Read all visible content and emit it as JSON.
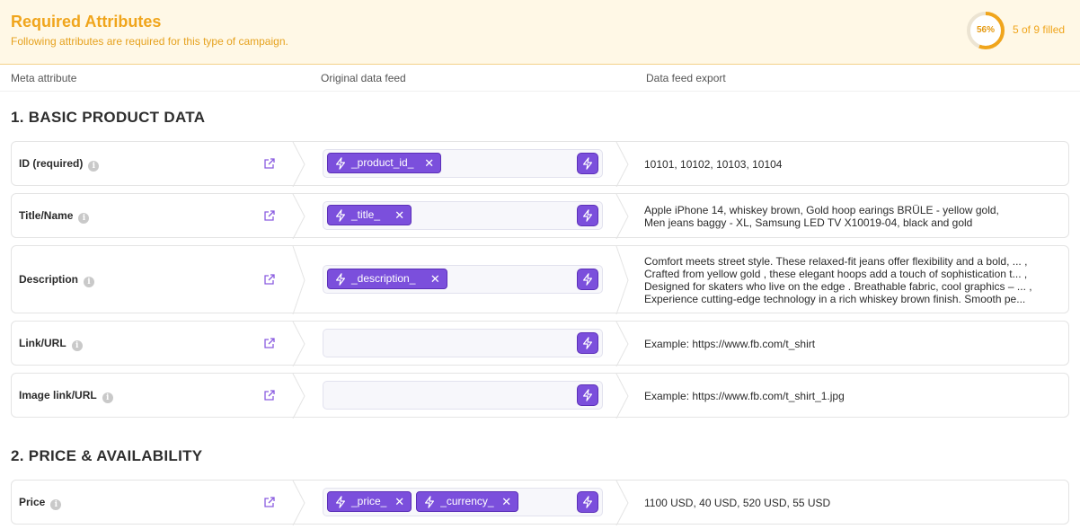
{
  "header": {
    "title": "Required Attributes",
    "subtitle": "Following attributes are required for this type of campaign.",
    "progress_percent": 56,
    "progress_label": "56%",
    "progress_text": "5 of 9 filled",
    "accent_color": "#f0a51c"
  },
  "columns": {
    "meta": "Meta attribute",
    "original": "Original data feed",
    "export": "Data feed export"
  },
  "sections": [
    {
      "title": "1. BASIC PRODUCT DATA"
    },
    {
      "title": "2. PRICE & AVAILABILITY"
    }
  ],
  "rows": [
    {
      "label": "ID (required)",
      "tags": [
        "_product_id_"
      ],
      "export": [
        "10101, 10102, 10103, 10104"
      ]
    },
    {
      "label": "Title/Name",
      "tags": [
        "_title_"
      ],
      "export": [
        "Apple iPhone 14, whiskey brown, Gold hoop earings BRÜLE - yellow gold,",
        "Men jeans baggy - XL, Samsung LED TV X10019-04, black and gold"
      ]
    },
    {
      "label": "Description",
      "tags": [
        "_description_"
      ],
      "export": [
        "Comfort meets street style. These relaxed-fit jeans offer flexibility and a bold, ... ,",
        "Crafted from yellow gold , these elegant hoops add a touch of sophistication t... ,",
        "Designed for skaters who live on the edge . Breathable fabric, cool graphics – ... ,",
        "Experience cutting-edge technology in a rich whiskey brown finish. Smooth pe..."
      ]
    },
    {
      "label": "Link/URL",
      "tags": [],
      "export": [
        "Example: https://www.fb.com/t_shirt"
      ]
    },
    {
      "label": "Image link/URL",
      "tags": [],
      "export": [
        "Example: https://www.fb.com/t_shirt_1.jpg"
      ]
    },
    {
      "label": "Price",
      "tags": [
        "_price_",
        "_currency_"
      ],
      "export": [
        "1100 USD, 40 USD, 520 USD, 55 USD"
      ]
    }
  ],
  "icons": {
    "info": "info-icon",
    "external": "external-link-icon",
    "bolt": "lightning-bolt-icon",
    "remove": "close-icon",
    "info_glyph": "i",
    "remove_glyph": "✕"
  },
  "colors": {
    "tag_bg": "#7b4fdc",
    "header_bg": "#fff8e6"
  }
}
